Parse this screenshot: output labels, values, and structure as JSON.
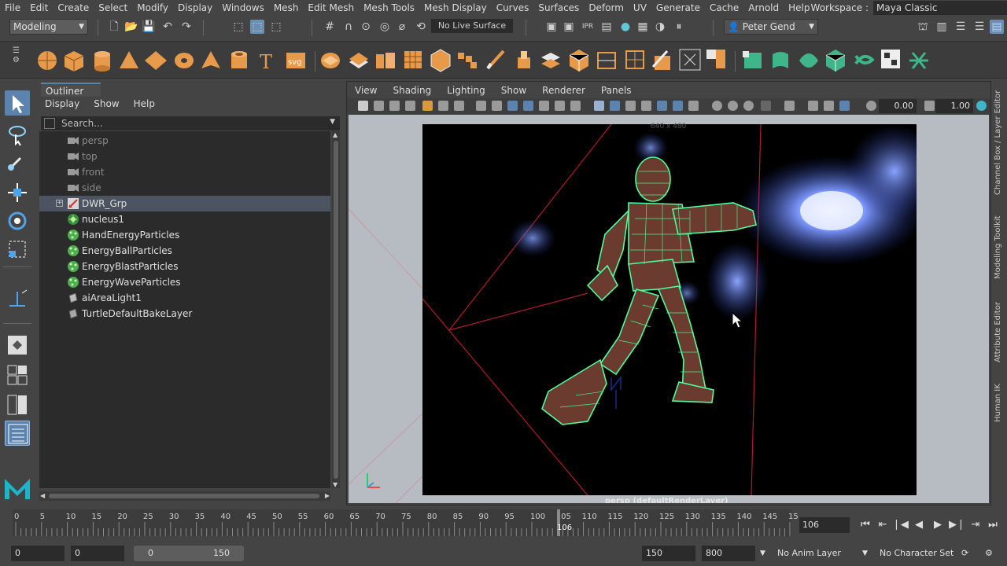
{
  "menubar": {
    "items": [
      "File",
      "Edit",
      "Create",
      "Select",
      "Modify",
      "Display",
      "Windows",
      "Mesh",
      "Edit Mesh",
      "Mesh Tools",
      "Mesh Display",
      "Curves",
      "Surfaces",
      "Deform",
      "UV",
      "Generate",
      "Cache",
      "Arnold",
      "Help"
    ],
    "workspace_label": "Workspace :",
    "workspace_value": "Maya Classic"
  },
  "statusline": {
    "mode": "Modeling",
    "live_surface": "No Live Surface",
    "user": "Peter Gend"
  },
  "outliner": {
    "title": "Outliner",
    "menu": [
      "Display",
      "Show",
      "Help"
    ],
    "search_placeholder": "Search...",
    "items": [
      {
        "label": "persp",
        "icon": "camera-icon",
        "dim": true
      },
      {
        "label": "top",
        "icon": "camera-icon",
        "dim": true
      },
      {
        "label": "front",
        "icon": "camera-icon",
        "dim": true
      },
      {
        "label": "side",
        "icon": "camera-icon",
        "dim": true
      },
      {
        "label": "DWR_Grp",
        "icon": "group-icon",
        "selected": true,
        "expandable": true
      },
      {
        "label": "nucleus1",
        "icon": "nucleus-icon"
      },
      {
        "label": "HandEnergyParticles",
        "icon": "particle-icon"
      },
      {
        "label": "EnergyBallParticles",
        "icon": "particle-icon"
      },
      {
        "label": "EnergyBlastParticles",
        "icon": "particle-icon"
      },
      {
        "label": "EnergyWaveParticles",
        "icon": "particle-icon"
      },
      {
        "label": "aiAreaLight1",
        "icon": "light-icon"
      },
      {
        "label": "TurtleDefaultBakeLayer",
        "icon": "layer-icon"
      }
    ]
  },
  "viewport": {
    "menu": [
      "View",
      "Shading",
      "Lighting",
      "Show",
      "Renderer",
      "Panels"
    ],
    "exposure": "0.00",
    "gamma": "1.00",
    "camera_label": "persp (defaultRenderLayer)",
    "resolution_label": "640 x 480"
  },
  "sidetabs": [
    "Channel Box / Layer Editor",
    "Modeling Toolkit",
    "Attribute Editor",
    "Human IK"
  ],
  "timeslider": {
    "ticks": [
      "0",
      "5",
      "10",
      "15",
      "20",
      "25",
      "30",
      "35",
      "40",
      "45",
      "50",
      "55",
      "60",
      "65",
      "70",
      "75",
      "80",
      "85",
      "90",
      "95",
      "100",
      "105",
      "110",
      "115",
      "120",
      "125",
      "130",
      "135",
      "140",
      "145",
      "15"
    ],
    "current_frame_marker": "106",
    "current_frame_field": "106"
  },
  "rangebar": {
    "start": "0",
    "playback_start": "0",
    "slider_low": "0",
    "slider_high": "150",
    "playback_end": "150",
    "end": "800",
    "anim_layer": "No Anim Layer",
    "character_set": "No Character Set"
  },
  "colors": {
    "wireframe": "#4dff9a",
    "energy": "#6f8cff",
    "selection": "#5b83ad"
  }
}
